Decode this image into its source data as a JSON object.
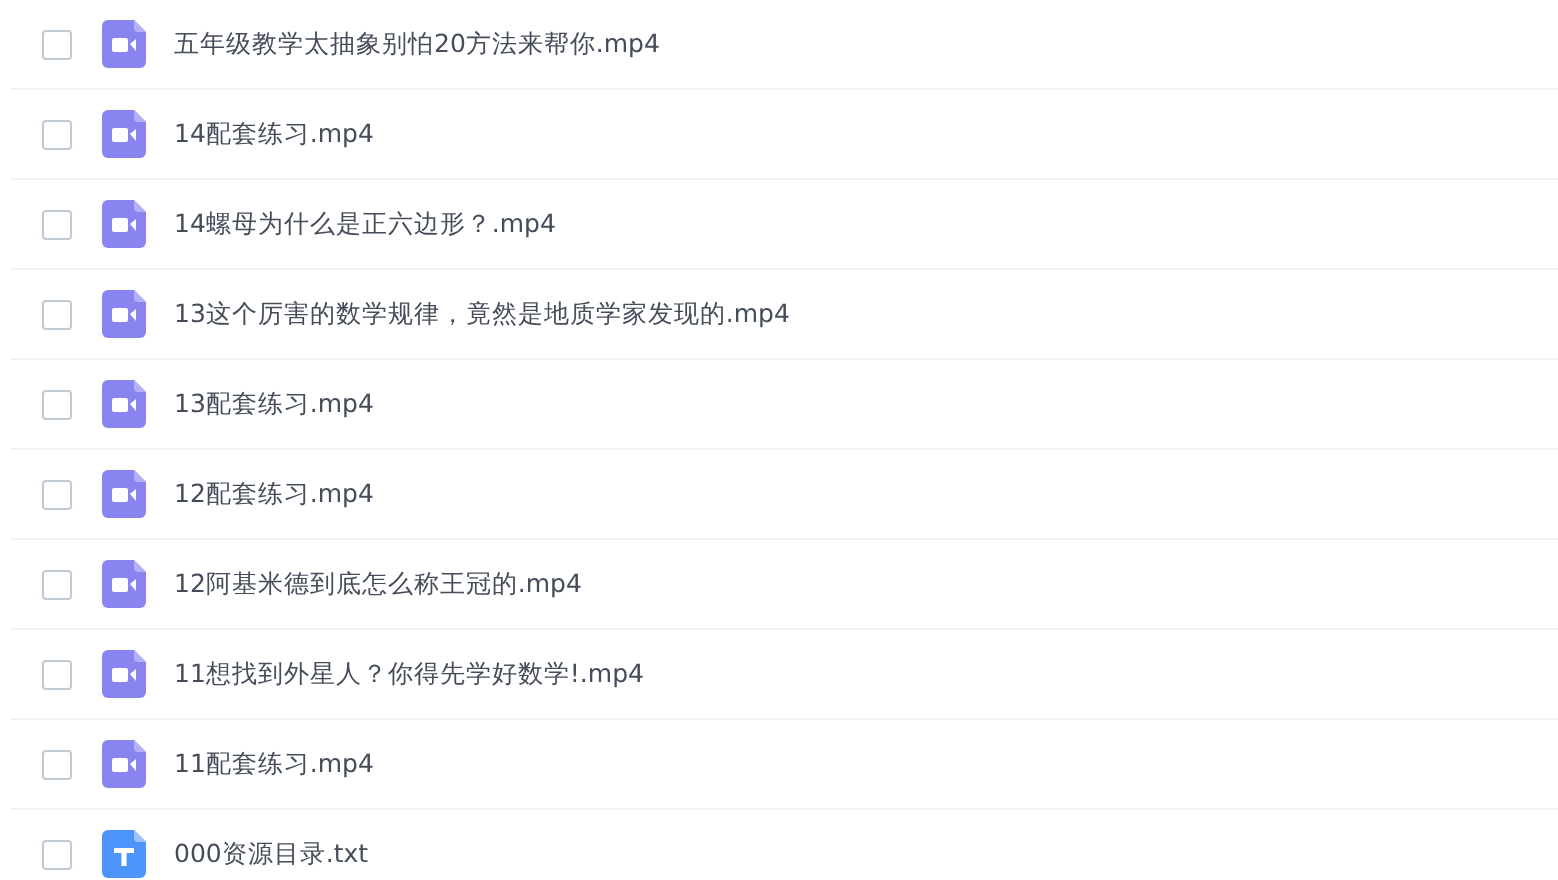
{
  "files": [
    {
      "name": "五年级教学太抽象别怕20方法来帮你.mp4",
      "kind": "video",
      "checked": false
    },
    {
      "name": "14配套练习.mp4",
      "kind": "video",
      "checked": false
    },
    {
      "name": "14螺母为什么是正六边形？.mp4",
      "kind": "video",
      "checked": false
    },
    {
      "name": "13这个厉害的数学规律，竟然是地质学家发现的.mp4",
      "kind": "video",
      "checked": false
    },
    {
      "name": "13配套练习.mp4",
      "kind": "video",
      "checked": false
    },
    {
      "name": "12配套练习.mp4",
      "kind": "video",
      "checked": false
    },
    {
      "name": "12阿基米德到底怎么称王冠的.mp4",
      "kind": "video",
      "checked": false
    },
    {
      "name": "11想找到外星人？你得先学好数学!.mp4",
      "kind": "video",
      "checked": false
    },
    {
      "name": "11配套练习.mp4",
      "kind": "video",
      "checked": false
    },
    {
      "name": "000资源目录.txt",
      "kind": "text",
      "checked": false
    }
  ]
}
